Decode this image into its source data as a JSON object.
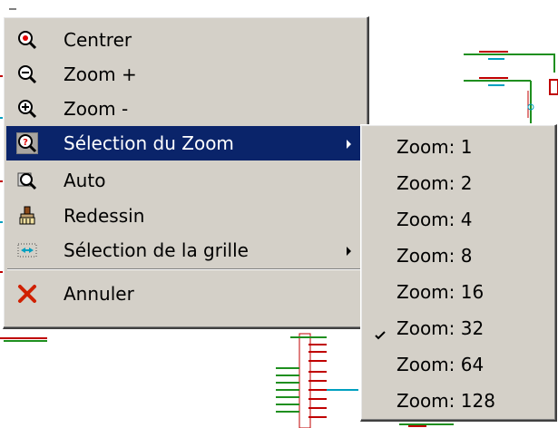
{
  "context_menu": {
    "items": [
      {
        "label": "Centrer",
        "icon": "center-zoom-icon",
        "submenu": false
      },
      {
        "label": "Zoom +",
        "icon": "zoom-in-icon",
        "submenu": false
      },
      {
        "label": "Zoom -",
        "icon": "zoom-out-icon",
        "submenu": false
      },
      {
        "label": "Sélection du Zoom",
        "icon": "zoom-select-icon",
        "submenu": true,
        "highlighted": true
      },
      {
        "label": "Auto",
        "icon": "zoom-auto-icon",
        "submenu": false
      },
      {
        "label": "Redessin",
        "icon": "redraw-brush-icon",
        "submenu": false
      },
      {
        "label": "Sélection de la grille",
        "icon": "grid-select-icon",
        "submenu": true
      },
      {
        "label": "Annuler",
        "icon": "cancel-x-icon",
        "submenu": false
      }
    ]
  },
  "zoom_submenu": {
    "items": [
      {
        "label": "Zoom: 1",
        "checked": false
      },
      {
        "label": "Zoom: 2",
        "checked": false
      },
      {
        "label": "Zoom: 4",
        "checked": false
      },
      {
        "label": "Zoom: 8",
        "checked": false
      },
      {
        "label": "Zoom: 16",
        "checked": false
      },
      {
        "label": "Zoom: 32",
        "checked": true
      },
      {
        "label": "Zoom: 64",
        "checked": false
      },
      {
        "label": "Zoom: 128",
        "checked": false
      }
    ]
  },
  "colors": {
    "menu_bg": "#d4d0c8",
    "highlight_bg": "#0a246a",
    "highlight_text": "#ffffff",
    "wire_green": "#1f8f1f",
    "pin_red": "#c00000",
    "label_cyan": "#00a0c0"
  }
}
